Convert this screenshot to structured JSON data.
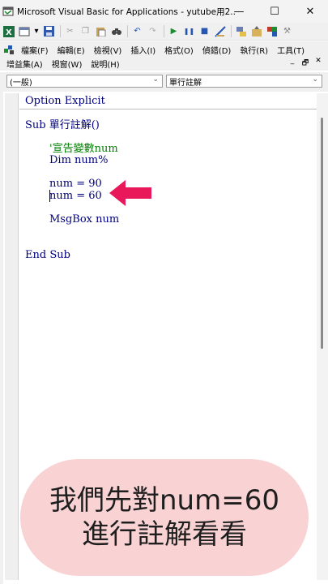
{
  "window": {
    "title": "Microsoft Visual Basic for Applications - yutube用2....",
    "minimize_glyph": "—",
    "maximize_glyph": "☐",
    "close_glyph": "✕"
  },
  "toolbar": {
    "icons": [
      "excel-icon",
      "insert-form-icon",
      "dropdown-icon",
      "save-icon",
      "cut-icon",
      "copy-icon",
      "paste-icon",
      "find-icon",
      "undo-icon",
      "redo-icon",
      "run-icon",
      "break-icon",
      "reset-icon",
      "design-mode-icon",
      "project-explorer-icon",
      "properties-icon",
      "object-browser-icon",
      "toolbox-icon"
    ],
    "accent": "#1a8f2e"
  },
  "menu": {
    "row1": [
      "檔案(F)",
      "編輯(E)",
      "檢視(V)",
      "插入(I)",
      "格式(O)",
      "偵錯(D)",
      "執行(R)",
      "工具(T)"
    ],
    "row2": [
      "增益集(A)",
      "視窗(W)",
      "說明(H)"
    ],
    "mdi_minimize": "_",
    "mdi_restore": "🗗",
    "mdi_close": "✕"
  },
  "combos": {
    "object": "(一般)",
    "procedure": "單行註解",
    "arrow": "⌄"
  },
  "code": {
    "lines": [
      "Option Explicit",
      "Sub 單行註解()",
      "'宣告變數num",
      "Dim num%",
      "num = 90",
      "num = 60",
      "MsgBox num",
      "End Sub"
    ],
    "keyword_color": "#00007f",
    "comment_color": "#008000"
  },
  "annotation": {
    "arrow_color": "#e8185a"
  },
  "caption": {
    "line1": "我們先對num=60",
    "line2": "進行註解看看",
    "background": "#f9d2d3"
  }
}
